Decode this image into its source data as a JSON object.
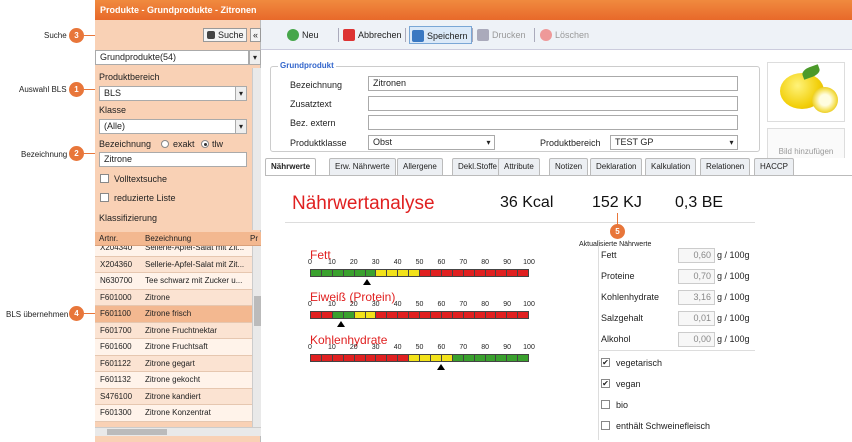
{
  "callouts": {
    "c1": {
      "num": "1",
      "label": "Auswahl BLS"
    },
    "c2": {
      "num": "2",
      "label": "Bezeichnung"
    },
    "c3": {
      "num": "3",
      "label": "Suche"
    },
    "c4": {
      "num": "4",
      "label": "BLS übernehmen"
    },
    "c5": {
      "num": "5",
      "label": "Aktualisierte Nährwerte"
    }
  },
  "window": {
    "title": "Produkte - Grundprodukte - Zitronen"
  },
  "sidebar": {
    "search_button": "Suche",
    "collapse_icon": "«",
    "category_select": "Grundprodukte(54)",
    "produktbereich_label": "Produktbereich",
    "produktbereich_value": "BLS",
    "klasse_label": "Klasse",
    "klasse_value": "(Alle)",
    "bezeichnung_label": "Bezeichnung",
    "exakt_label": "exakt",
    "tlw_label": "tlw",
    "bezeichnung_value": "Zitrone",
    "volltextsuche_label": "Volltextsuche",
    "reduzierte_label": "reduzierte Liste",
    "klassifizierung_label": "Klassifizierung",
    "col_artnr": "Artnr.",
    "col_bezeichnung": "Bezeichnung",
    "col_pr": "Pr",
    "rows": [
      {
        "artnr": "X204340",
        "name": "Sellerie-Apfel-Salat mit Zit..."
      },
      {
        "artnr": "X204360",
        "name": "Sellerie-Apfel-Salat mit Zit..."
      },
      {
        "artnr": "N630700",
        "name": "Tee schwarz mit Zucker u..."
      },
      {
        "artnr": "F601000",
        "name": "Zitrone"
      },
      {
        "artnr": "F601100",
        "name": "Zitrone frisch"
      },
      {
        "artnr": "F601700",
        "name": "Zitrone Fruchtnektar"
      },
      {
        "artnr": "F601600",
        "name": "Zitrone Fruchtsaft"
      },
      {
        "artnr": "F601122",
        "name": "Zitrone gegart"
      },
      {
        "artnr": "F601132",
        "name": "Zitrone gekocht"
      },
      {
        "artnr": "S476100",
        "name": "Zitrone kandiert"
      },
      {
        "artnr": "F601300",
        "name": "Zitrone Konzentrat"
      }
    ]
  },
  "toolbar": {
    "neu": "Neu",
    "abbrechen": "Abbrechen",
    "speichern": "Speichern",
    "drucken": "Drucken",
    "loeschen": "Löschen"
  },
  "form": {
    "section": "Grundprodukt",
    "bezeichnung_label": "Bezeichnung",
    "bezeichnung_value": "Zitronen",
    "zusatztext_label": "Zusatztext",
    "bez_extern_label": "Bez. extern",
    "produktklasse_label": "Produktklasse",
    "produktklasse_value": "Obst",
    "produktbereich_label": "Produktbereich",
    "produktbereich_value": "TEST GP",
    "bild_hinzufuegen": "Bild hinzufügen"
  },
  "tabs": [
    "Nährwerte",
    "Erw. Nährwerte",
    "Allergene",
    "Dekl.Stoffe",
    "Attribute",
    "Notizen",
    "Deklaration",
    "Kalkulation",
    "Relationen",
    "HACCP"
  ],
  "analysis": {
    "title": "Nährwertanalyse",
    "kcal": "36 Kcal",
    "kj": "152 KJ",
    "be": "0,3 BE"
  },
  "scales": {
    "ticks": [
      "0",
      "10",
      "20",
      "30",
      "40",
      "50",
      "60",
      "70",
      "80",
      "90",
      "100"
    ],
    "fett": {
      "label": "Fett",
      "marker_percent": 26
    },
    "eiweiss": {
      "label": "Eiweiß (Protein)",
      "marker_percent": 14
    },
    "kohlenhydrate": {
      "label": "Kohlenhydrate",
      "marker_percent": 60
    }
  },
  "nutrients": [
    {
      "name": "Fett",
      "value": "0,60",
      "unit": "g / 100g"
    },
    {
      "name": "Proteine",
      "value": "0,70",
      "unit": "g / 100g"
    },
    {
      "name": "Kohlenhydrate",
      "value": "3,16",
      "unit": "g / 100g"
    },
    {
      "name": "Salzgehalt",
      "value": "0,01",
      "unit": "g / 100g"
    },
    {
      "name": "Alkohol",
      "value": "0,00",
      "unit": "g / 100g"
    }
  ],
  "flags": [
    {
      "label": "vegetarisch",
      "checked": true
    },
    {
      "label": "vegan",
      "checked": true
    },
    {
      "label": "bio",
      "checked": false
    },
    {
      "label": "enthält Schweinefleisch",
      "checked": false
    }
  ],
  "colors": {
    "accent": "#e8763a",
    "red": "#e02020",
    "green": "#3aa12e",
    "yellow": "#f2e21a"
  }
}
